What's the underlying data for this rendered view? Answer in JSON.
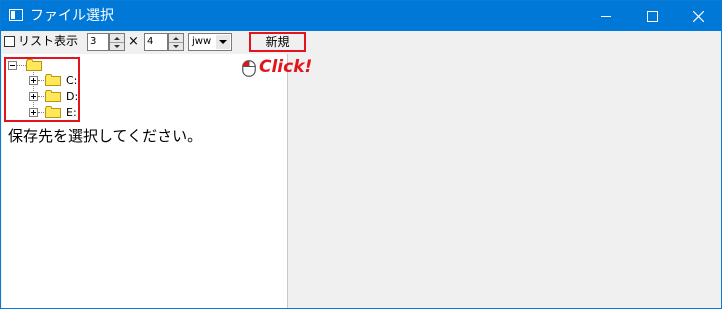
{
  "window": {
    "title": "ファイル選択"
  },
  "toolbar": {
    "list_view_label": "リスト表示",
    "list_view_checked": false,
    "columns_value": "3",
    "times_symbol": "×",
    "rows_value": "4",
    "file_type_selected": "jww",
    "new_button_label": "新規"
  },
  "tree": {
    "drives": [
      {
        "label": "C:"
      },
      {
        "label": "D:"
      },
      {
        "label": "E:"
      }
    ]
  },
  "instruction": "保存先を選択してください。",
  "annotation": {
    "click_text": "Click!"
  },
  "colors": {
    "titlebar": "#0078d7",
    "highlight": "#e3141b",
    "folder": "#ffe75c"
  }
}
